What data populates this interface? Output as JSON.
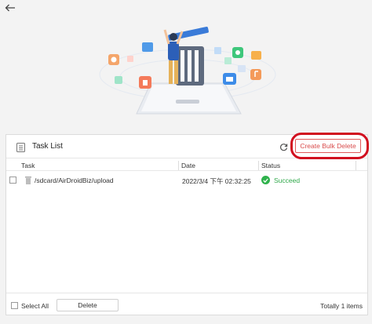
{
  "panel": {
    "title": "Task List",
    "bulk_delete_label": "Create Bulk Delete"
  },
  "table": {
    "columns": [
      "Task",
      "Date",
      "Status"
    ],
    "rows": [
      {
        "task": "/sdcard/AirDroidBiz/upload",
        "date": "2022/3/4 下午 02:32:25",
        "status": "Succeed"
      }
    ]
  },
  "footer": {
    "select_all_label": "Select All",
    "delete_label": "Delete",
    "total_label": "Totally 1 items"
  },
  "colors": {
    "accent_red": "#d94a4a",
    "highlight_ring": "#d10f1f",
    "success_green": "#2fb24c"
  },
  "icons": {
    "back": "arrow-left-icon",
    "list": "list-icon",
    "refresh": "refresh-icon",
    "file": "trash-file-icon",
    "status": "check-circle-icon"
  }
}
